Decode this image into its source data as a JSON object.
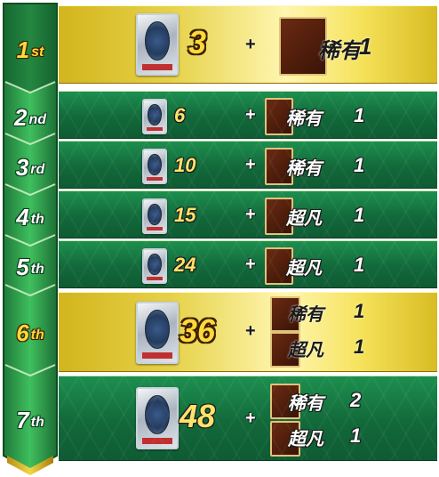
{
  "ranks": [
    {
      "num": "1",
      "suffix": "st",
      "highlight": true
    },
    {
      "num": "2",
      "suffix": "nd",
      "highlight": false
    },
    {
      "num": "3",
      "suffix": "rd",
      "highlight": false
    },
    {
      "num": "4",
      "suffix": "th",
      "highlight": false
    },
    {
      "num": "5",
      "suffix": "th",
      "highlight": false
    },
    {
      "num": "6",
      "suffix": "th",
      "highlight": true
    },
    {
      "num": "7",
      "suffix": "th",
      "highlight": false
    }
  ],
  "rewards": [
    {
      "packs": "3",
      "plus": "+",
      "cards": [
        {
          "rarity": "稀有",
          "qty": "1"
        }
      ]
    },
    {
      "packs": "6",
      "plus": "+",
      "cards": [
        {
          "rarity": "稀有",
          "qty": "1"
        }
      ]
    },
    {
      "packs": "10",
      "plus": "+",
      "cards": [
        {
          "rarity": "稀有",
          "qty": "1"
        }
      ]
    },
    {
      "packs": "15",
      "plus": "+",
      "cards": [
        {
          "rarity": "超凡",
          "qty": "1"
        }
      ]
    },
    {
      "packs": "24",
      "plus": "+",
      "cards": [
        {
          "rarity": "超凡",
          "qty": "1"
        }
      ]
    },
    {
      "packs": "36",
      "plus": "+",
      "cards": [
        {
          "rarity": "稀有",
          "qty": "1"
        },
        {
          "rarity": "超凡",
          "qty": "1"
        }
      ]
    },
    {
      "packs": "48",
      "plus": "+",
      "cards": [
        {
          "rarity": "稀有",
          "qty": "2"
        },
        {
          "rarity": "超凡",
          "qty": "1"
        }
      ]
    }
  ],
  "icons": {
    "pack": "card-pack-icon",
    "card": "card-back-icon"
  },
  "colors": {
    "rank_column_green": "#2f9e4c",
    "row_green": "#127040",
    "row_gold": "#e6d24a",
    "count_yellow": "#ffe26a"
  }
}
